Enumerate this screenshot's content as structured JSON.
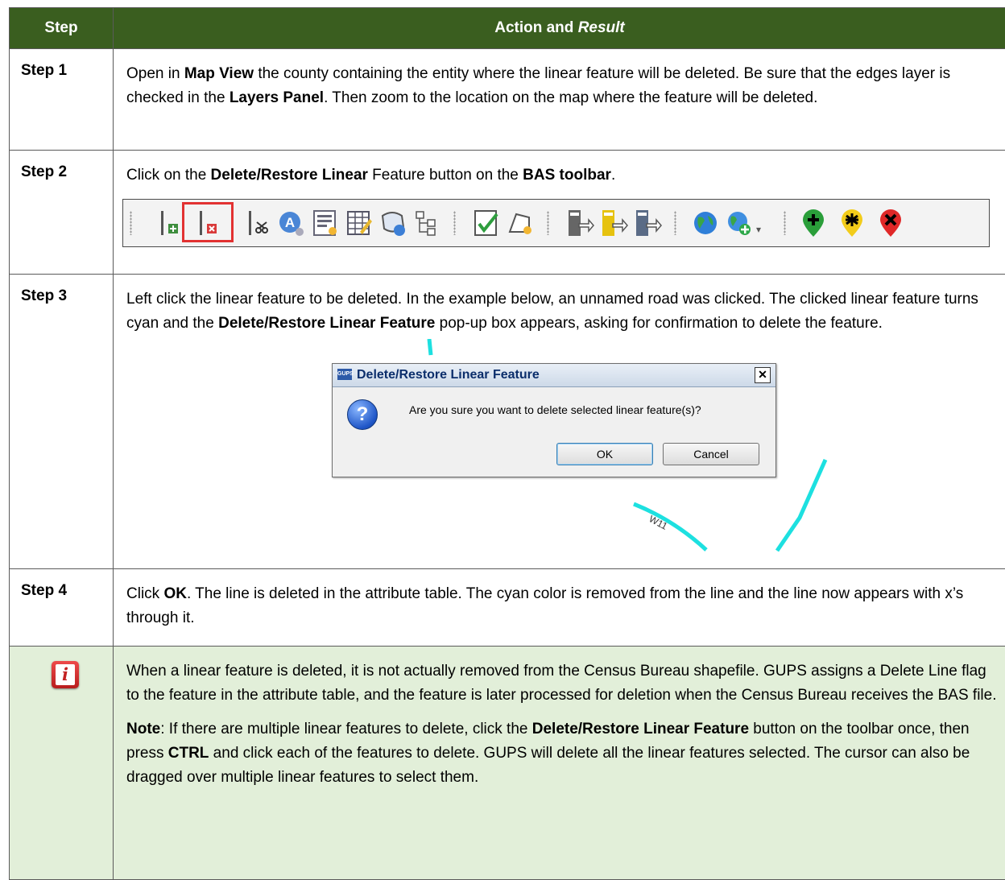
{
  "header": {
    "col_step": "Step",
    "col_action": "Action and ",
    "col_action_italic": "Result"
  },
  "step1": {
    "label": "Step 1",
    "t1": "Open in ",
    "b1": "Map View",
    "t2": " the county containing the entity where the linear feature will be deleted. Be sure that the edges layer is checked in the ",
    "b2": "Layers Panel",
    "t3": ". Then zoom to the location on the map where the feature will be deleted."
  },
  "step2": {
    "label": "Step 2",
    "t1": "Click on the ",
    "b1": "Delete/Restore Linear",
    "t2": " Feature button on the ",
    "b2": "BAS toolbar",
    "t3": "."
  },
  "toolbar": {
    "icons": [
      "add-linear-icon",
      "delete-linear-icon",
      "split-line-icon",
      "add-name-icon",
      "attribute-form-icon",
      "attribute-table-icon",
      "boundary-icon",
      "tree-icon",
      "review-icon",
      "new-polygon-icon",
      "import-icon",
      "export-icon",
      "export-yellow-icon",
      "globe-icon",
      "globe-add-icon",
      "add-point-icon",
      "star-point-icon",
      "delete-point-icon"
    ]
  },
  "step3": {
    "label": "Step 3",
    "t1": "Left click the linear feature to be deleted. In the example below, an unnamed road was clicked. The clicked linear feature turns cyan and the ",
    "b1": "Delete/Restore Linear Feature",
    "t2": " pop-up box appears, asking for confirmation to delete the feature.",
    "dialog": {
      "logo": "GUPS",
      "title": "Delete/Restore Linear Feature",
      "close": "✕",
      "question": "?",
      "message": "Are you sure you want to delete selected linear feature(s)?",
      "ok": "OK",
      "cancel": "Cancel"
    },
    "map_label": "W11"
  },
  "step4": {
    "label": "Step 4",
    "t1": "Click ",
    "b1": "OK",
    "t2": ". The line is deleted in the attribute table. The cyan color is removed from the line and the line now appears with x’s through it."
  },
  "note": {
    "icon": "i",
    "p1": "When a linear feature is deleted, it is not actually removed from the Census Bureau shapefile. GUPS assigns a Delete Line flag to the feature in the attribute table, and the feature is later processed for deletion when the Census Bureau receives the BAS file.",
    "n_label": "Note",
    "n1": ":  If there are multiple linear features to delete, click the ",
    "nb1": "Delete/Restore Linear Feature",
    "n2": " button on the toolbar once, then press ",
    "nb2": "CTRL",
    "n3": " and click each of the features to delete. GUPS will delete all the linear features selected. The cursor can also be dragged over multiple linear features to select them."
  },
  "colors": {
    "header_bg": "#3a5e1f",
    "note_bg": "#e2efd9",
    "cyan_line": "#1de0e0",
    "highlight": "#e23232"
  }
}
